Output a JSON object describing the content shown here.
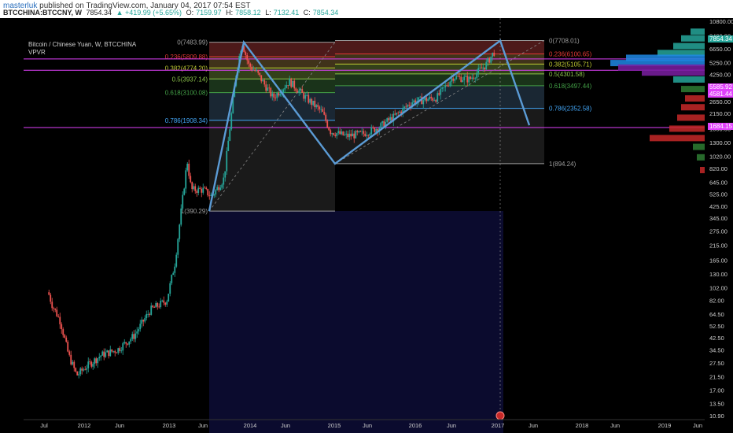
{
  "header": {
    "author": "masterluk",
    "published": "published on TradingView.com, January 04, 2017 07:54 EST"
  },
  "info": {
    "symbol": "BTCCHINA:BTCCNY, W",
    "last": "7854.34",
    "change": "▲ +419.99 (+5.65%)",
    "open_label": "O:",
    "open": "7159.97",
    "high_label": "H:",
    "high": "7858.12",
    "low_label": "L:",
    "low": "7132.41",
    "close_label": "C:",
    "close": "7854.34"
  },
  "legend": {
    "title": "Bitcoin / Chinese Yuan, W, BTCCHINA",
    "indicator": "VPVR"
  },
  "price_tags": {
    "last": "7854.34",
    "magenta1": "5585.92",
    "magenta2": "4581.44",
    "magenta3": "1684.15"
  },
  "chart_data": {
    "type": "line",
    "scale": "log",
    "y_ticks": [
      "10800.00",
      "8400.00",
      "6650.00",
      "5250.00",
      "4250.00",
      "3250.00",
      "2650.00",
      "2150.00",
      "1650.00",
      "1300.00",
      "1020.00",
      "820.00",
      "645.00",
      "525.00",
      "425.00",
      "345.00",
      "275.00",
      "215.00",
      "165.00",
      "130.00",
      "102.00",
      "82.00",
      "64.50",
      "52.50",
      "42.50",
      "34.50",
      "27.50",
      "21.50",
      "17.00",
      "13.50",
      "10.90"
    ],
    "x_ticks": [
      "Jul",
      "2012",
      "Jun",
      "2013",
      "Jun",
      "2014",
      "Jun",
      "2015",
      "Jun",
      "2016",
      "Jun",
      "2017",
      "Jun",
      "2018",
      "Jun",
      "2019",
      "Jun"
    ],
    "fib1_labels": [
      {
        "text": "0(7483.99)",
        "value": 7483.99,
        "color": "#9e9e9e"
      },
      {
        "text": "0.236(5809.88)",
        "value": 5809.88,
        "color": "#e53935"
      },
      {
        "text": "0.382(4774.20)",
        "value": 4774.2,
        "color": "#c0ca33"
      },
      {
        "text": "0.5(3937.14)",
        "value": 3937.14,
        "color": "#8bc34a"
      },
      {
        "text": "0.618(3100.08)",
        "value": 3100.08,
        "color": "#43a047"
      },
      {
        "text": "0.786(1908.34)",
        "value": 1908.34,
        "color": "#42a5f5"
      },
      {
        "text": "1(390.29)",
        "value": 390.29,
        "color": "#9e9e9e"
      }
    ],
    "fib2_labels": [
      {
        "text": "0(7708.01)",
        "value": 7708.01,
        "color": "#9e9e9e"
      },
      {
        "text": "0.236(6100.65)",
        "value": 6100.65,
        "color": "#e53935"
      },
      {
        "text": "0.382(5105.71)",
        "value": 5105.71,
        "color": "#c0ca33"
      },
      {
        "text": "0.5(4301.58)",
        "value": 4301.58,
        "color": "#8bc34a"
      },
      {
        "text": "0.618(3497.44)",
        "value": 3497.44,
        "color": "#43a047"
      },
      {
        "text": "0.786(2352.58)",
        "value": 2352.58,
        "color": "#42a5f5"
      },
      {
        "text": "1(894.24)",
        "value": 894.24,
        "color": "#9e9e9e"
      }
    ],
    "pattern_points": [
      {
        "date": "2013-06",
        "price": 390
      },
      {
        "date": "2013-12",
        "price": 7480
      },
      {
        "date": "2015-01",
        "price": 894
      },
      {
        "date": "2016-12",
        "price": 7700
      },
      {
        "date": "2017-04",
        "price": 1750
      }
    ]
  }
}
